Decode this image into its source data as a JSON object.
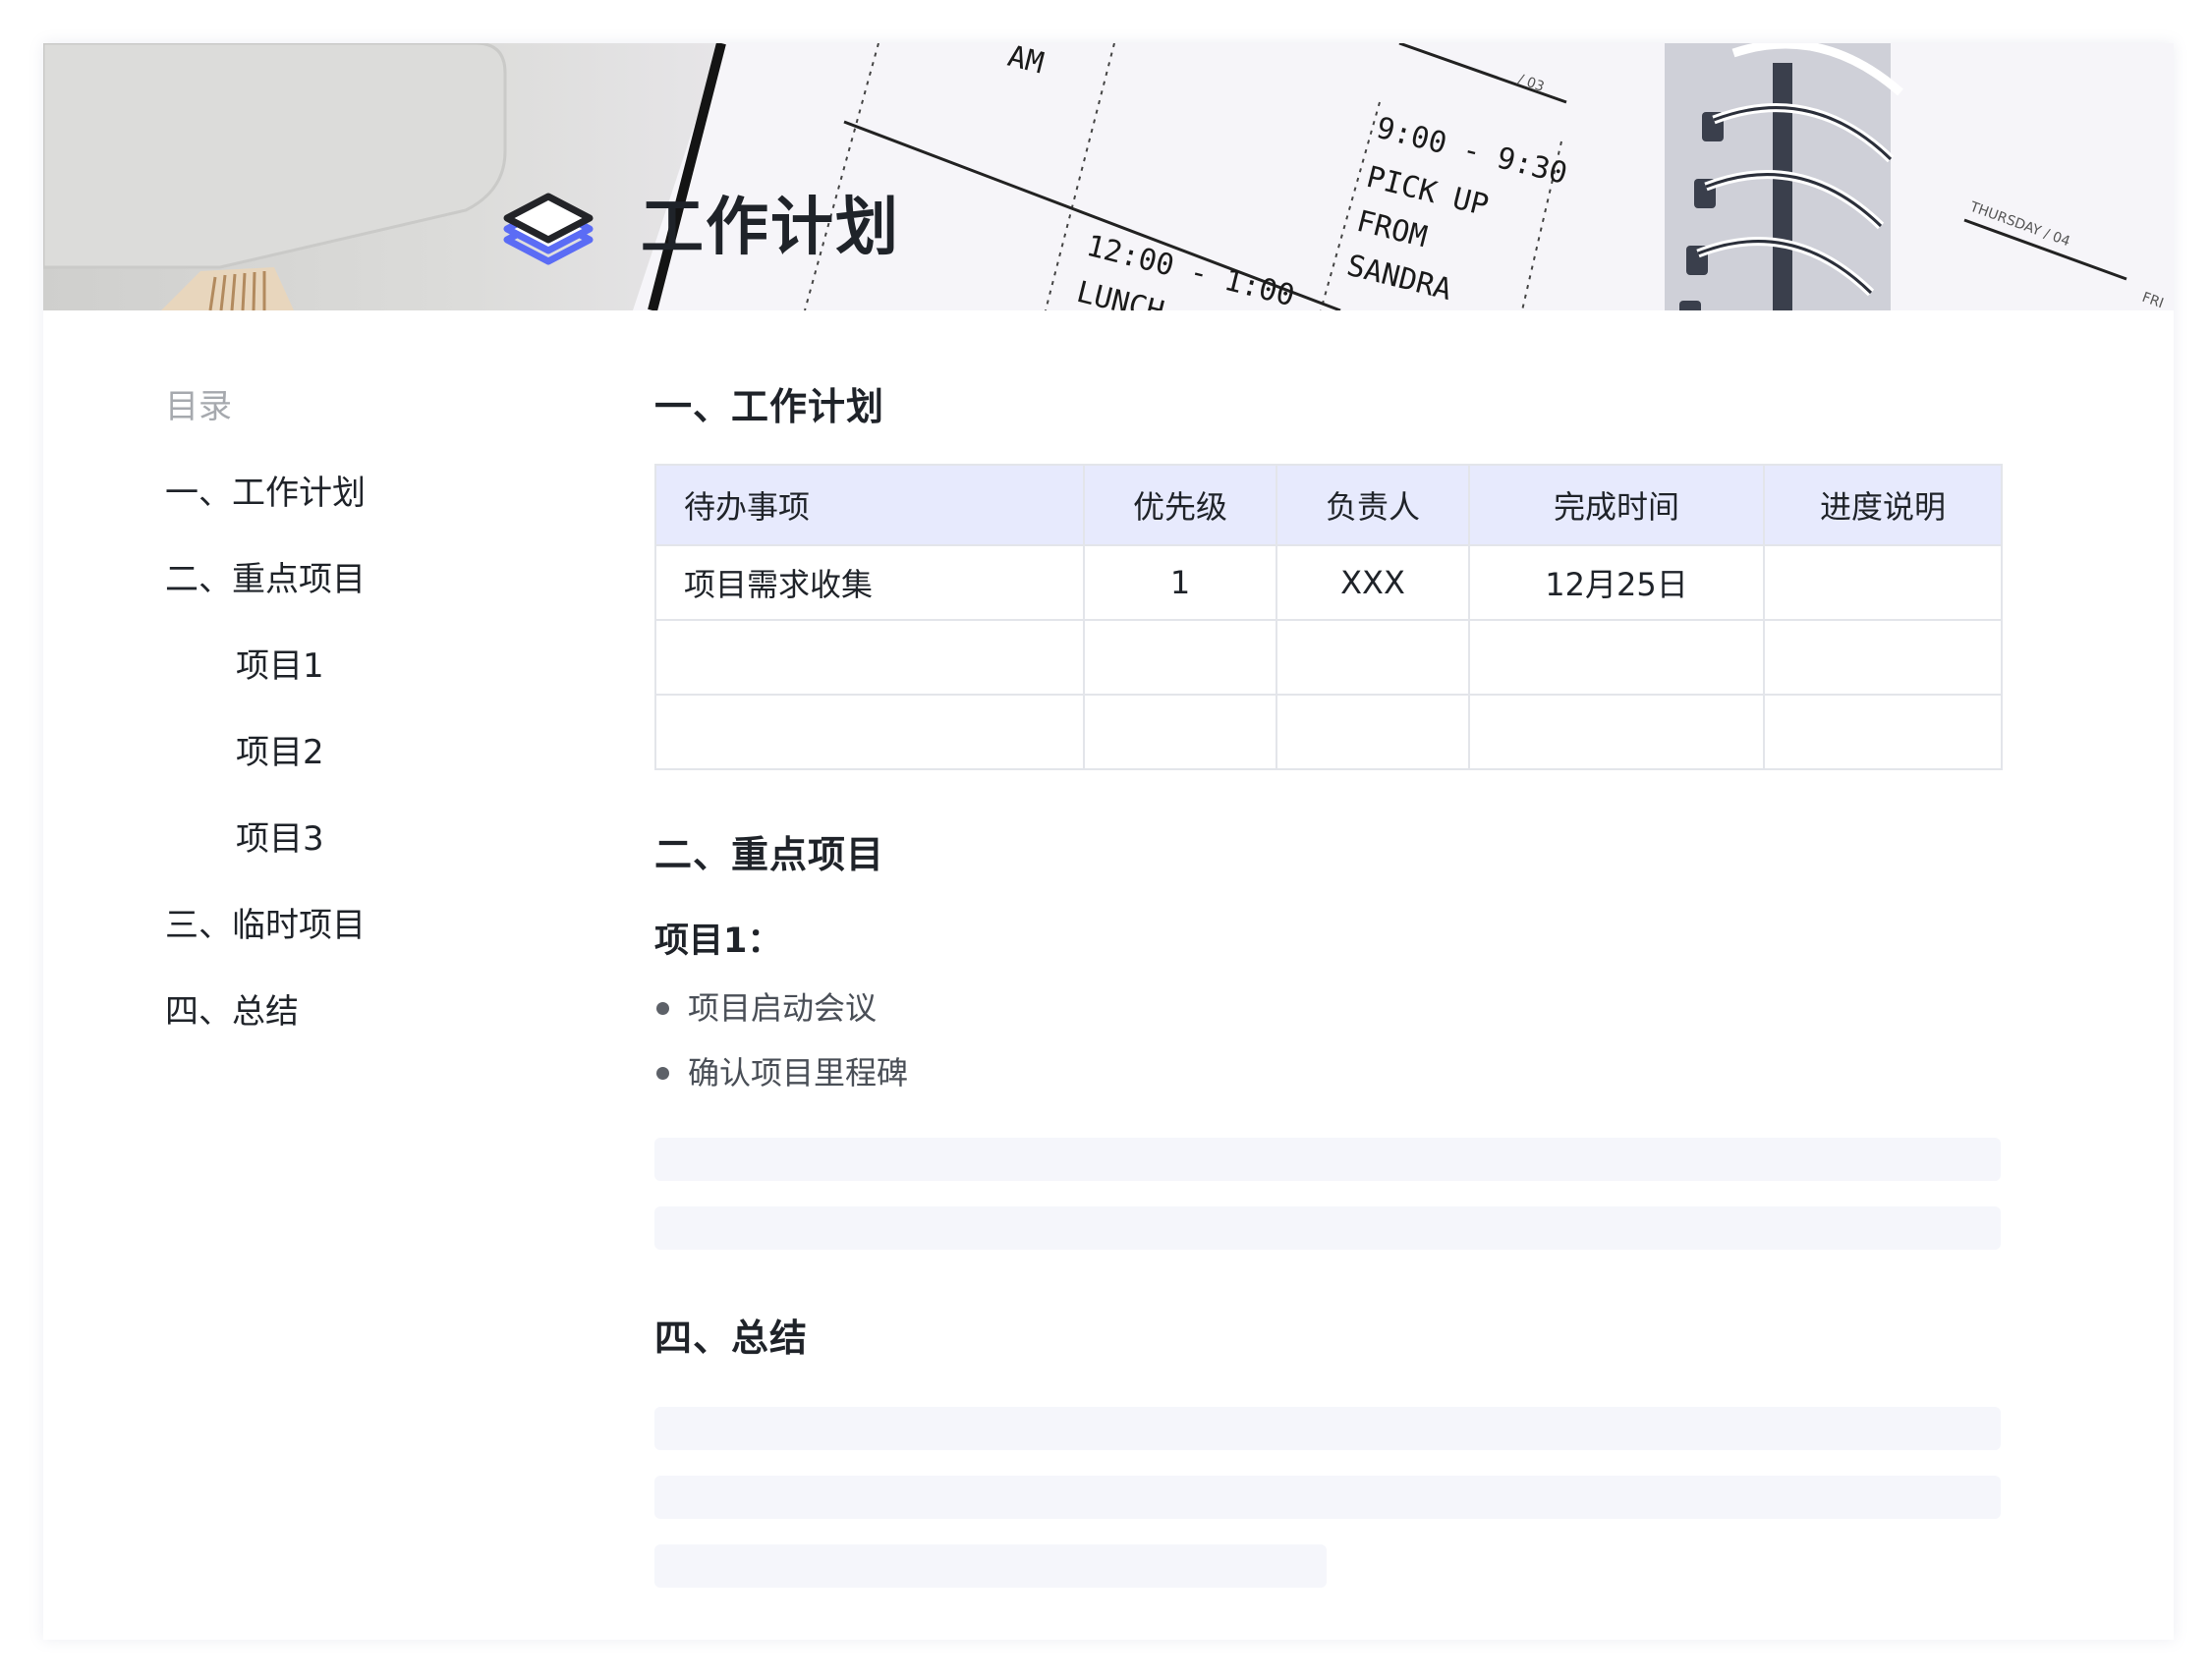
{
  "document": {
    "title": "工作计划"
  },
  "banner": {
    "handwriting": [
      "9:00 - 9:30",
      "PICK UP",
      "FROM",
      "SANDRA",
      "12:00 - 1:00",
      "LUNCH",
      "THURSDAY / 04",
      "/ 03",
      "FRI"
    ]
  },
  "toc": {
    "heading": "目录",
    "items": [
      {
        "label": "一、工作计划",
        "level": 1
      },
      {
        "label": "二、重点项目",
        "level": 1
      },
      {
        "label": "项目1",
        "level": 2
      },
      {
        "label": "项目2",
        "level": 2
      },
      {
        "label": "项目3",
        "level": 2
      },
      {
        "label": "三、临时项目",
        "level": 1
      },
      {
        "label": "四、总结",
        "level": 1
      }
    ]
  },
  "sections": {
    "work_plan": {
      "heading": "一、工作计划",
      "table": {
        "headers": [
          "待办事项",
          "优先级",
          "负责人",
          "完成时间",
          "进度说明"
        ],
        "rows": [
          [
            "项目需求收集",
            "1",
            "XXX",
            "12月25日",
            ""
          ],
          [
            "",
            "",
            "",
            "",
            ""
          ],
          [
            "",
            "",
            "",
            "",
            ""
          ]
        ]
      }
    },
    "key_projects": {
      "heading": "二、重点项目",
      "project1": {
        "heading": "项目1：",
        "bullets": [
          "项目启动会议",
          "确认项目里程碑"
        ]
      }
    },
    "summary": {
      "heading": "四、总结"
    }
  },
  "colors": {
    "accent": "#5b6cf5",
    "table_header_bg": "#e7eafd",
    "placeholder_bg": "#f5f6fb",
    "toc_heading": "#a6a9ae"
  },
  "icons": {
    "document_icon": "layers-icon"
  }
}
